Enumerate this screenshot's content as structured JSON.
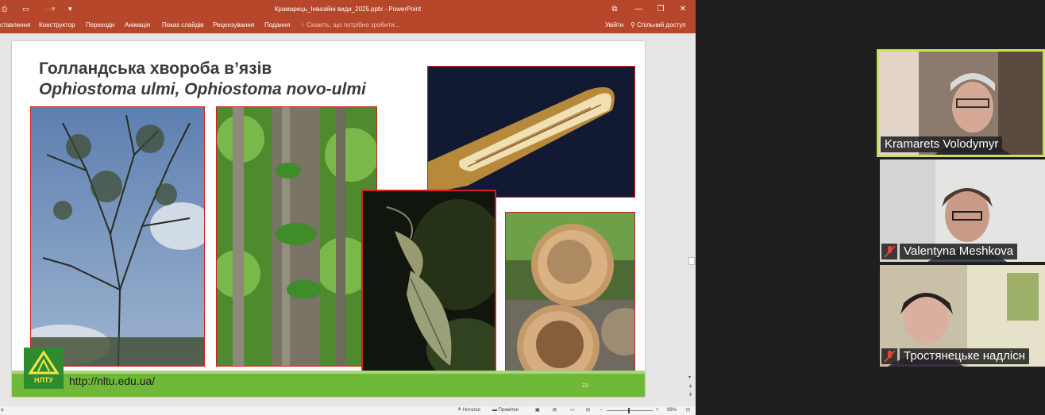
{
  "window": {
    "title": "Крамарець_Інвазійні види_2025.pptx - PowerPoint",
    "controls": [
      "⧉",
      "—",
      "❐",
      "✕"
    ]
  },
  "ribbon": {
    "tabs": [
      "ставлення",
      "Конструктор",
      "Переходи",
      "Анімація",
      "Показ слайдів",
      "Рецензування",
      "Подання"
    ],
    "tell_me": "Скажіть, що потрібно зробити...",
    "sign_in": "Увійти",
    "share": "Спільний доступ"
  },
  "slide": {
    "title": "Голландська хвороба в’язів",
    "subtitle": "Ophiostoma ulmi, Ophiostoma novo-ulmi",
    "url": "http://nltu.edu.ua/",
    "page_number": "23",
    "logo_text": "НЛТУ"
  },
  "status": {
    "notes": "Нотатки",
    "comments": "Примітки",
    "zoom": "99%",
    "left_text": "а"
  },
  "participants": [
    {
      "name": "Kramarets Volodymyr",
      "muted": false,
      "active": true
    },
    {
      "name": "Valentyna Meshkova",
      "muted": true,
      "active": false
    },
    {
      "name": "Тростянецьке надлісн",
      "muted": true,
      "active": false
    }
  ],
  "colors": {
    "accent": "#b7472a",
    "band": "#6fb838",
    "speaker_border": "#c8e06a",
    "mute_red": "#e0443a"
  }
}
